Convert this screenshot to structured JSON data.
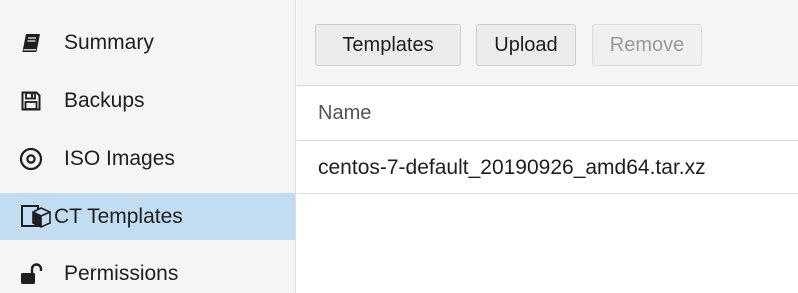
{
  "sidebar": {
    "items": [
      {
        "label": "Summary",
        "icon": "book-icon",
        "active": false
      },
      {
        "label": "Backups",
        "icon": "floppy-disk-icon",
        "active": false
      },
      {
        "label": "ISO Images",
        "icon": "disc-icon",
        "active": false
      },
      {
        "label": "CT Templates",
        "icon": "ct-templates-cube-icon",
        "active": true
      },
      {
        "label": "Permissions",
        "icon": "unlock-icon",
        "active": false
      }
    ],
    "active_color": "#c2ddf2"
  },
  "toolbar": {
    "templates_label": "Templates",
    "upload_label": "Upload",
    "remove_label": "Remove"
  },
  "grid": {
    "columns": [
      "Name"
    ],
    "rows": [
      {
        "name": "centos-7-default_20190926_amd64.tar.xz"
      }
    ]
  }
}
